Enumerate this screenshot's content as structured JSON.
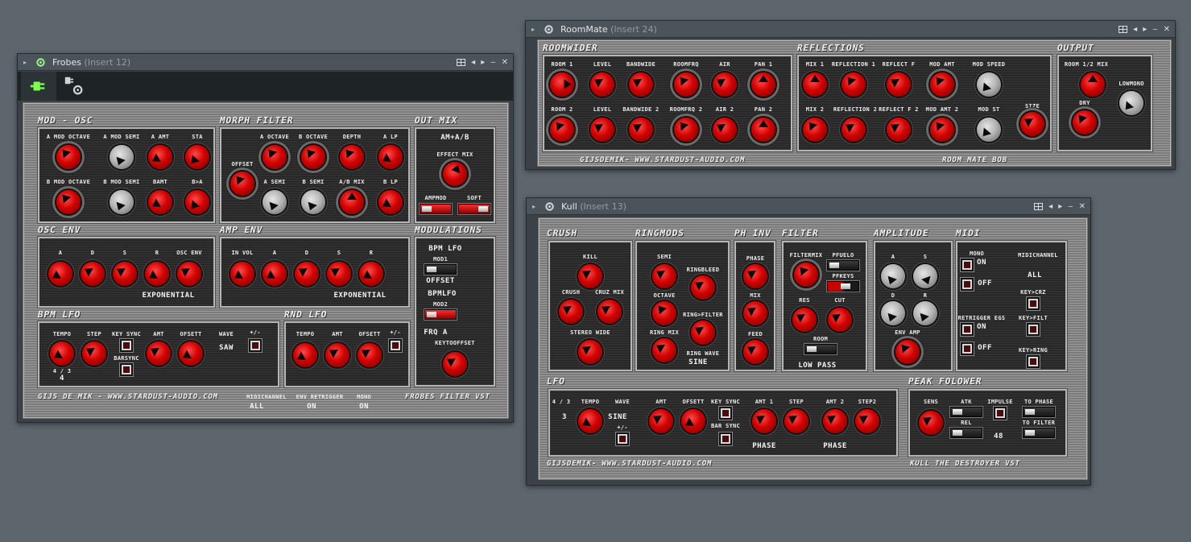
{
  "frobes": {
    "title": "Frobes",
    "insert": "(Insert 12)",
    "sections": {
      "mod_osc": "MOD - OSC",
      "morph_filter": "MORPH FILTER",
      "out_mix": "OUT MIX",
      "osc_env": "OSC ENV",
      "amp_env": "AMP ENV",
      "modulations": "MODULATIONS",
      "bpm_lfo": "BPM LFO",
      "rnd_lfo": "RND LFO"
    },
    "labels": {
      "a_mod_octave": "A MOD OCTAVE",
      "a_mod_semi": "A MOD SEMI",
      "a_amt": "A AMT",
      "sta": "STA",
      "b_mod_octave": "B MOD OCTAVE",
      "b_mod_semi": "B MOD SEMI",
      "bamt": "BAMT",
      "b_a": "B>A",
      "offset": "OFFSET",
      "a_octave": "A OCTAVE",
      "b_octave": "B OCTAVE",
      "depth": "DEPTH",
      "a_lp": "A LP",
      "a_semi": "A SEMI",
      "b_semi": "B SEMI",
      "ab_mix": "A/B MIX",
      "b_lp": "B LP",
      "am_ab": "AM+A/B",
      "effect_mix": "EFFECT MIX",
      "ampmod": "AMPMOD",
      "soft": "SOFT",
      "env_a": "A",
      "env_d": "D",
      "env_s": "S",
      "env_r": "R",
      "osc_env": "OSC ENV",
      "exponential": "EXPONENTIAL",
      "in_vol": "IN VOL",
      "amp_a": "A",
      "amp_d": "D",
      "amp_s": "S",
      "amp_r": "R",
      "amp_exponential": "EXPONENTIAL",
      "bpm_lfo": "BPM LFO",
      "mod1": "MOD1",
      "offset_mod": "OFFSET",
      "bpmlfo": "BPMLFO",
      "mod2": "MOD2",
      "frq_a": "FRQ A",
      "keytooffset": "KEYTOOFFSET",
      "tempo": "TEMPO",
      "step": "STEP",
      "key_sync": "KEY SYNC",
      "amt": "AMT",
      "ofsett": "OFSETT",
      "wave": "WAVE",
      "plusminus": "+/-",
      "barsync": "BARSYNC",
      "saw": "SAW",
      "ratio": "4 / 3",
      "four": "4",
      "rnd_tempo": "TEMPO",
      "rnd_amt": "AMT",
      "rnd_ofsett": "OFSETT",
      "rnd_pm": "+/-"
    },
    "footer": {
      "credit": "GIJS DE MIK - WWW.STARDUST-AUDIO.COM",
      "midichannel": "MIDICHANNEL",
      "midichannel_val": "ALL",
      "env_retrigger": "ENV RETRIGGER",
      "env_retrigger_val": "ON",
      "mono": "MONO",
      "mono_val": "ON",
      "product": "FROBES FILTER VST"
    }
  },
  "roommate": {
    "title": "RoomMate",
    "insert": "(Insert 24)",
    "sections": {
      "roomwider": "ROOMWIDER",
      "reflections": "REFLECTIONS",
      "output": "OUTPUT"
    },
    "labels": {
      "room1": "ROOM 1",
      "level1": "LEVEL",
      "bandwide": "BANDWIDE",
      "roomfrq": "ROOMFRQ",
      "air": "AIR",
      "pan1": "PAN 1",
      "room2": "ROOM 2",
      "level2": "LEVEL",
      "bandwide2": "BANDWIDE 2",
      "roomfrq2": "ROOMFRQ 2",
      "air2": "AIR 2",
      "pan2": "PAN 2",
      "mix1": "MIX 1",
      "reflection1": "REFLECTION 1",
      "reflectf": "REFLECT F",
      "modamt": "MOD AMT",
      "modspeed": "MOD SPEED",
      "mix2": "MIX 2",
      "reflection2": "REFLECTION 2",
      "reflectf2": "REFLECT F 2",
      "modamt2": "MOD AMT 2",
      "modst": "MOD ST",
      "size": "SIZE",
      "room12mix": "ROOM 1/2 MIX",
      "dry": "DRY",
      "lowmono": "LOWMONO"
    },
    "footer": {
      "credit": "GIJSDEMIK- WWW.STARDUST-AUDIO.COM",
      "product": "ROOM MATE BOB"
    }
  },
  "kull": {
    "title": "Kull",
    "insert": "(Insert 13)",
    "sections": {
      "crush": "CRUSH",
      "ringmods": "RINGMODS",
      "ph_inv": "PH INV",
      "filter": "FILTER",
      "amplitude": "AMPLITUDE",
      "midi": "MIDI",
      "lfo": "LFO",
      "peak_folower": "PEAK FOLOWER"
    },
    "labels": {
      "kill": "KILL",
      "crush": "CRUSH",
      "cruzmix": "CRUZ MIX",
      "stereowide": "STEREO WIDE",
      "semi": "SEMI",
      "ringbleed": "RINGBLEED",
      "octave": "OCTAVE",
      "ringfilter": "RING>FILTER",
      "ringmix": "RING MIX",
      "ringwave": "RING WAVE",
      "sine": "SINE",
      "phase": "PHASE",
      "mix": "MIX",
      "feed": "FEED",
      "filtermix": "FILTERMIX",
      "pfuelo": "PFUELO",
      "pfkeys": "PFKEYS",
      "res": "RES",
      "cut": "CUT",
      "room": "ROOM",
      "lowpass": "LOW PASS",
      "amp_a": "A",
      "amp_s": "S",
      "amp_d": "D",
      "amp_r": "R",
      "envamp": "ENV AMP",
      "mono": "MONO",
      "on": "ON",
      "off": "OFF",
      "midichannel": "MIDICHANNEL",
      "all": "ALL",
      "keycrz": "KEY>CRZ",
      "retrigger": "RETRIGGER EGS",
      "on2": "ON",
      "off2": "OFF",
      "keyfilt": "KEY>FILT",
      "keyring": "KEY>RING",
      "lfo_ratio": "4 / 3",
      "lfo_tempo": "TEMPO",
      "lfo_three": "3",
      "lfo_wave": "WAVE",
      "lfo_sine": "SINE",
      "lfo_pm": "+/-",
      "lfo_amt": "AMT",
      "lfo_ofsett": "OFSETT",
      "lfo_keysync": "KEY SYNC",
      "lfo_barsync": "BAR SYNC",
      "lfo_amt1": "AMT 1",
      "lfo_step": "STEP",
      "lfo_phase1": "PHASE",
      "lfo_amt2": "AMT 2",
      "lfo_step2": "STEP2",
      "lfo_phase2": "PHASE",
      "sens": "SENS",
      "atk": "ATK",
      "rel": "REL",
      "impulse": "IMPULSE",
      "impulse_val": "48",
      "to_phase": "TO PHASE",
      "to_filter": "TO FILTER"
    },
    "footer": {
      "credit": "GIJSDEMIK- WWW.STARDUST-AUDIO.COM",
      "product": "KULL THE DESTROYER VST"
    }
  },
  "window_controls": {
    "prev": "◂",
    "next": "▸",
    "minimize": "‒",
    "close": "✕",
    "collapse": "▸"
  },
  "colors": {
    "accent_red": "#d10000",
    "knob_grey": "#b4b4b4",
    "desktop": "#5d656d",
    "tab_green": "#7cff4a"
  }
}
